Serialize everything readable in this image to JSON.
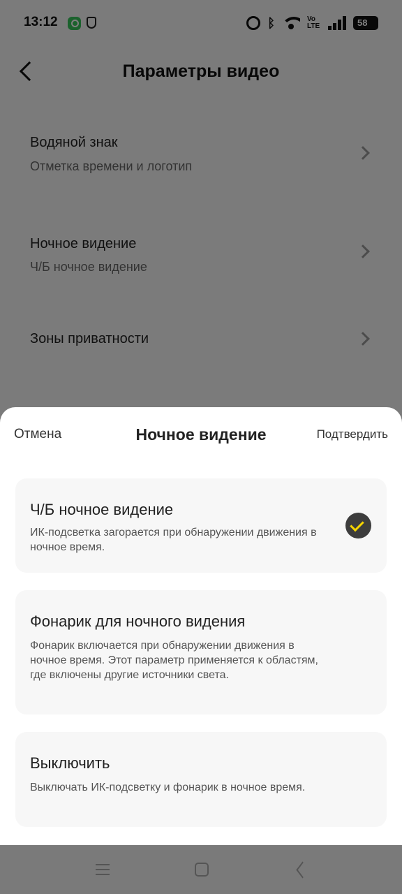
{
  "status_bar": {
    "time": "13:12",
    "volte": "Vo LTE",
    "battery": "58"
  },
  "header": {
    "title": "Параметры видео"
  },
  "settings": [
    {
      "title": "Водяной знак",
      "subtitle": "Отметка времени и логотип"
    },
    {
      "title": "Ночное видение",
      "subtitle": "Ч/Б ночное видение"
    },
    {
      "title": "Зоны приватности",
      "subtitle": ""
    }
  ],
  "sheet": {
    "cancel": "Отмена",
    "title": "Ночное видение",
    "confirm": "Подтвердить",
    "options": [
      {
        "title": "Ч/Б ночное видение",
        "description": "ИК-подсветка загорается при обнаружении движения в ночное время.",
        "selected": true
      },
      {
        "title": "Фонарик для ночного видения",
        "description": "Фонарик включается при обнаружении движения в ночное время. Этот параметр применяется к областям, где включены другие источники света.",
        "selected": false
      },
      {
        "title": "Выключить",
        "description": "Выключать ИК-подсветку и фонарик в ночное время.",
        "selected": false
      }
    ]
  },
  "colors": {
    "check_accent": "#f5d400",
    "check_bg": "#3d3d3d"
  }
}
